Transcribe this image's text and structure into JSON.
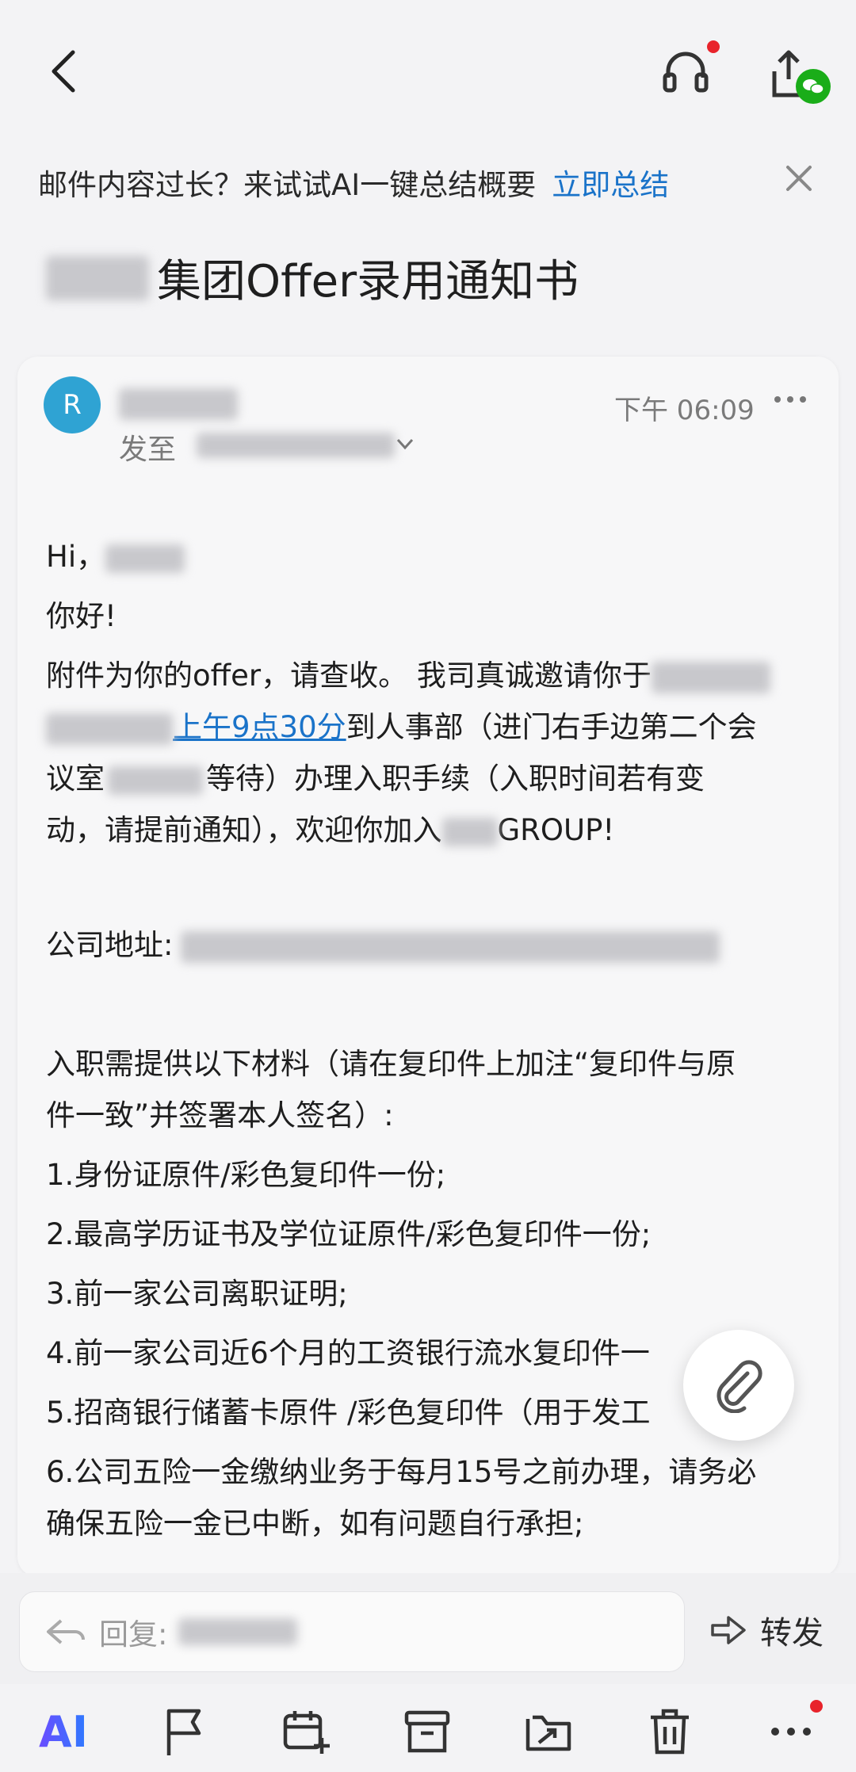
{
  "nav": {
    "back_icon": "chevron-left-icon",
    "listen_icon": "headset-icon",
    "share_icon": "share-icon"
  },
  "banner": {
    "text": "邮件内容过长？来试试AI一键总结概要",
    "action": "立即总结",
    "close_icon": "close-icon"
  },
  "subject": "集团Offer录用通知书",
  "email": {
    "avatar_letter": "R",
    "to_label": "发至",
    "time": "下午 06:09",
    "greeting": "Hi，",
    "hello": "你好!",
    "p1_start": "附件为你的offer，请查收。 我司真诚邀请你于",
    "p1_link": "上午9点30分",
    "p1_after_link": "到人事部（进门右手边第二个会",
    "p1_line3_a": "议室",
    "p1_line3_b": "等待）办理入职手续（入职时间若有变",
    "p1_line4_a": "动，请提前通知），欢迎你加入",
    "p1_line4_b": "GROUP!",
    "address_label": "公司地址:",
    "materials_intro_1": "入职需提供以下材料（请在复印件上加注“复印件与原",
    "materials_intro_2": "件一致”并签署本人签名）:",
    "items": [
      "1.身份证原件/彩色复印件一份;",
      "2.最高学历证书及学位证原件/彩色复印件一份;",
      "3.前一家公司离职证明;",
      "4.前一家公司近6个月的工资银行流水复印件一",
      "5.招商银行储蓄卡原件 /彩色复印件（用于发工",
      "6.公司五险一金缴纳业务于每月15号之前办理，请务必",
      "确保五险一金已中断，如有问题自行承担;"
    ]
  },
  "reply": {
    "label": "回复:",
    "forward_label": "转发"
  },
  "toolbar": {
    "ai_label": "AI"
  },
  "colors": {
    "accent_blue": "#1a73c9",
    "avatar": "#2fa3d3",
    "badge_red": "#e8232b",
    "wechat_green": "#1aad19"
  }
}
